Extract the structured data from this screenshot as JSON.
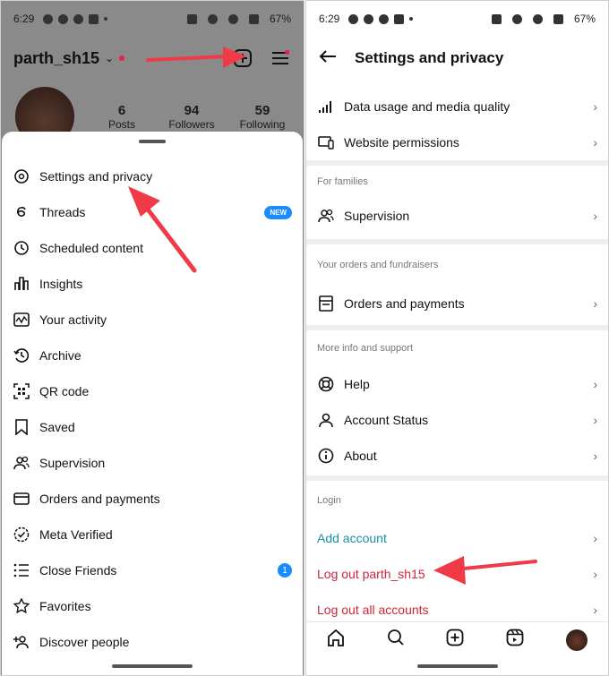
{
  "status_bar": {
    "time": "6:29",
    "battery": "67%"
  },
  "profile": {
    "username": "parth_sh15",
    "stats": [
      {
        "value": "6",
        "label": "Posts"
      },
      {
        "value": "94",
        "label": "Followers"
      },
      {
        "value": "59",
        "label": "Following"
      }
    ]
  },
  "menu": {
    "items": [
      {
        "label": "Settings and privacy",
        "icon": "settings-icon"
      },
      {
        "label": "Threads",
        "icon": "threads-icon",
        "badge": "NEW"
      },
      {
        "label": "Scheduled content",
        "icon": "clock-icon"
      },
      {
        "label": "Insights",
        "icon": "bar-chart-icon"
      },
      {
        "label": "Your activity",
        "icon": "activity-icon"
      },
      {
        "label": "Archive",
        "icon": "archive-icon"
      },
      {
        "label": "QR code",
        "icon": "qr-code-icon"
      },
      {
        "label": "Saved",
        "icon": "bookmark-icon"
      },
      {
        "label": "Supervision",
        "icon": "people-icon"
      },
      {
        "label": "Orders and payments",
        "icon": "card-icon"
      },
      {
        "label": "Meta Verified",
        "icon": "verified-icon"
      },
      {
        "label": "Close Friends",
        "icon": "list-icon",
        "count": "1"
      },
      {
        "label": "Favorites",
        "icon": "star-icon"
      },
      {
        "label": "Discover people",
        "icon": "add-person-icon"
      }
    ]
  },
  "settings": {
    "title": "Settings and privacy",
    "rows_top": [
      {
        "label": "Data usage and media quality",
        "icon": "signal-icon"
      },
      {
        "label": "Website permissions",
        "icon": "laptop-icon"
      }
    ],
    "sections": [
      {
        "heading": "For families",
        "rows": [
          {
            "label": "Supervision",
            "icon": "people-icon"
          }
        ]
      },
      {
        "heading": "Your orders and fundraisers",
        "rows": [
          {
            "label": "Orders and payments",
            "icon": "receipt-icon"
          }
        ]
      },
      {
        "heading": "More info and support",
        "rows": [
          {
            "label": "Help",
            "icon": "lifebuoy-icon"
          },
          {
            "label": "Account Status",
            "icon": "person-icon"
          },
          {
            "label": "About",
            "icon": "info-icon"
          }
        ]
      }
    ],
    "login": {
      "heading": "Login",
      "add_account": "Add account",
      "log_out": "Log out parth_sh15",
      "log_out_all": "Log out all accounts"
    }
  },
  "colors": {
    "accent_blue": "#1a8cff",
    "link_teal": "#1a8fa8",
    "logout_red": "#d0243a",
    "arrow_red": "#f03a47"
  }
}
